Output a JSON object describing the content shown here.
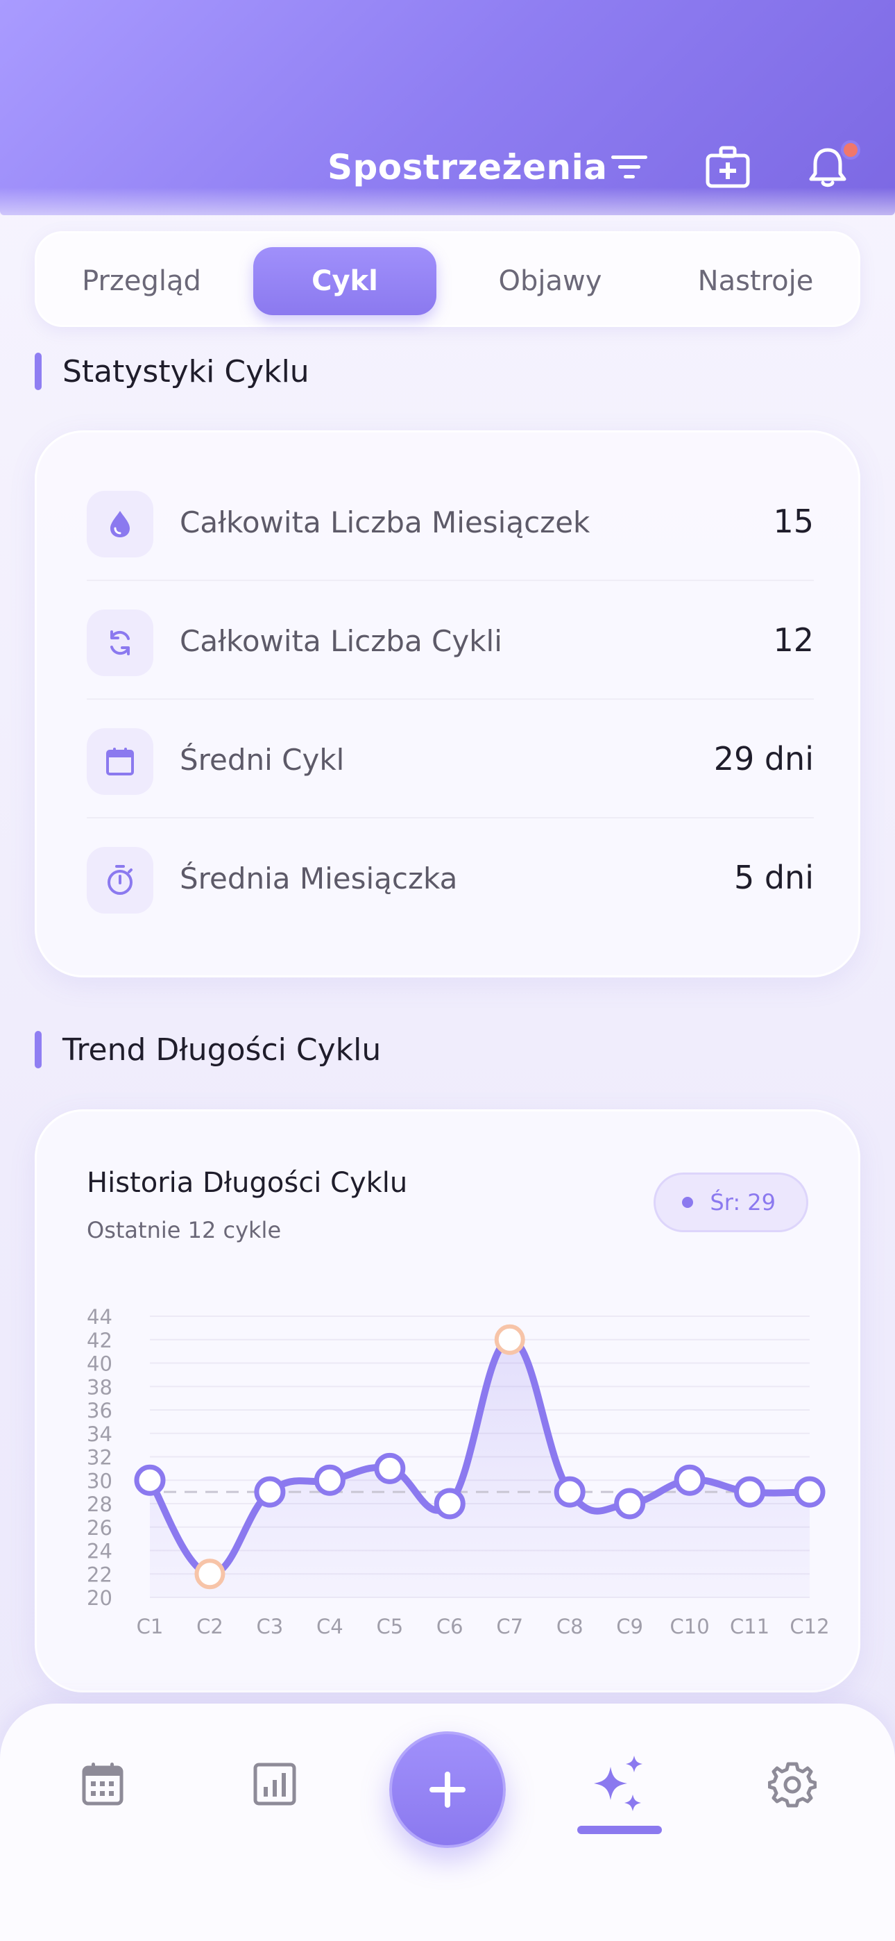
{
  "header": {
    "title": "Spostrzeżenia",
    "icons": [
      "filter-icon",
      "medical-kit-icon",
      "bell-icon"
    ],
    "gradient": [
      "#a99bff",
      "#7c68e3"
    ],
    "notification_dot_color": "#f0776b"
  },
  "tabs": [
    {
      "label": "Przegląd",
      "active": false
    },
    {
      "label": "Cykl",
      "active": true
    },
    {
      "label": "Objawy",
      "active": false
    },
    {
      "label": "Nastroje",
      "active": false
    }
  ],
  "stats_section": {
    "title": "Statystyki Cyklu",
    "rows": [
      {
        "icon": "drop-icon",
        "label": "Całkowita Liczba Miesiączek",
        "value": "15"
      },
      {
        "icon": "cycle-icon",
        "label": "Całkowita Liczba Cykli",
        "value": "12"
      },
      {
        "icon": "calendar-icon",
        "label": "Średni Cykl",
        "value": "29 dni"
      },
      {
        "icon": "timer-icon",
        "label": "Średnia Miesiączka",
        "value": "5 dni"
      }
    ]
  },
  "trend_section": {
    "title": "Trend Długości Cyklu",
    "card_title": "Historia Długości Cyklu",
    "card_subtitle": "Ostatnie 12 cykle",
    "avg_badge": "Śr: 29"
  },
  "chart_data": {
    "type": "line",
    "categories": [
      "C1",
      "C2",
      "C3",
      "C4",
      "C5",
      "C6",
      "C7",
      "C8",
      "C9",
      "C10",
      "C11",
      "C12"
    ],
    "values": [
      30,
      22,
      29,
      30,
      31,
      28,
      42,
      29,
      28,
      30,
      29,
      29
    ],
    "ylim": [
      20,
      44
    ],
    "yticks": [
      44,
      42,
      40,
      38,
      36,
      34,
      32,
      30,
      28,
      26,
      24,
      22,
      20
    ],
    "average": 29,
    "outliers": [
      "C2",
      "C7"
    ],
    "line_color": "#8b79ef",
    "outlier_color": "#f7c4a8",
    "grid": true
  },
  "bottom_nav": {
    "items": [
      "calendar-icon",
      "chart-icon",
      "add-icon",
      "sparkles-icon",
      "gear-icon"
    ],
    "active": "sparkles-icon",
    "accent": "#8b79ef"
  }
}
